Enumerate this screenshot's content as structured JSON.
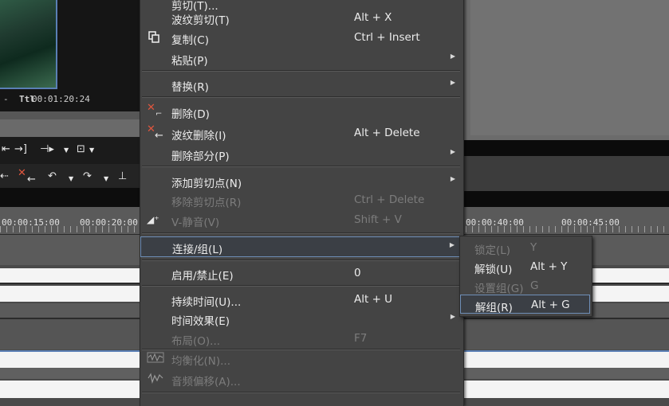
{
  "preview": {
    "timecode_label": "Ttl",
    "timecode": "00:01:20:24",
    "left_mark": "-"
  },
  "ruler": {
    "labels": [
      "00:00:15:00",
      "00:00:20:00",
      "00:00:40:00",
      "00:00:45:00"
    ]
  },
  "menu": {
    "items": [
      {
        "label": "剪切(T)...",
        "shortcut": "",
        "disabled": false,
        "submenu": false
      },
      {
        "label": "波纹剪切(T)",
        "shortcut": "Alt + X",
        "disabled": false,
        "submenu": false
      },
      {
        "label": "复制(C)",
        "shortcut": "Ctrl + Insert",
        "disabled": false,
        "submenu": false,
        "icon": "copy-icon"
      },
      {
        "label": "粘贴(P)",
        "shortcut": "",
        "disabled": false,
        "submenu": true
      },
      {
        "label": "替换(R)",
        "shortcut": "",
        "disabled": false,
        "submenu": true
      },
      {
        "label": "删除(D)",
        "shortcut": "",
        "disabled": false,
        "submenu": false,
        "icon": "delete-icon"
      },
      {
        "label": "波纹删除(I)",
        "shortcut": "Alt + Delete",
        "disabled": false,
        "submenu": false,
        "icon": "ripple-delete-icon"
      },
      {
        "label": "删除部分(P)",
        "shortcut": "",
        "disabled": false,
        "submenu": true
      },
      {
        "label": "添加剪切点(N)",
        "shortcut": "",
        "disabled": false,
        "submenu": true
      },
      {
        "label": "移除剪切点(R)",
        "shortcut": "Ctrl + Delete",
        "disabled": true,
        "submenu": false
      },
      {
        "label": "V-静音(V)",
        "shortcut": "Shift + V",
        "disabled": true,
        "submenu": false,
        "icon": "mute-icon"
      },
      {
        "label": "连接/组(L)",
        "shortcut": "",
        "disabled": false,
        "submenu": true,
        "highlighted": true
      },
      {
        "label": "启用/禁止(E)",
        "shortcut": "0",
        "disabled": false,
        "submenu": false
      },
      {
        "label": "持续时间(U)...",
        "shortcut": "Alt + U",
        "disabled": false,
        "submenu": false
      },
      {
        "label": "时间效果(E)",
        "shortcut": "",
        "disabled": false,
        "submenu": true
      },
      {
        "label": "布局(O)...",
        "shortcut": "F7",
        "disabled": true,
        "submenu": false
      },
      {
        "label": "均衡化(N)...",
        "shortcut": "",
        "disabled": true,
        "submenu": false,
        "icon": "equalize-icon"
      },
      {
        "label": "音频偏移(A)...",
        "shortcut": "",
        "disabled": true,
        "submenu": false,
        "icon": "audio-offset-icon"
      }
    ]
  },
  "submenu": {
    "items": [
      {
        "label": "锁定(L)",
        "shortcut": "Y",
        "disabled": true
      },
      {
        "label": "解锁(U)",
        "shortcut": "Alt + Y",
        "disabled": false
      },
      {
        "label": "设置组(G)",
        "shortcut": "G",
        "disabled": true
      },
      {
        "label": "解组(R)",
        "shortcut": "Alt + G",
        "disabled": false,
        "highlighted": true
      }
    ]
  }
}
